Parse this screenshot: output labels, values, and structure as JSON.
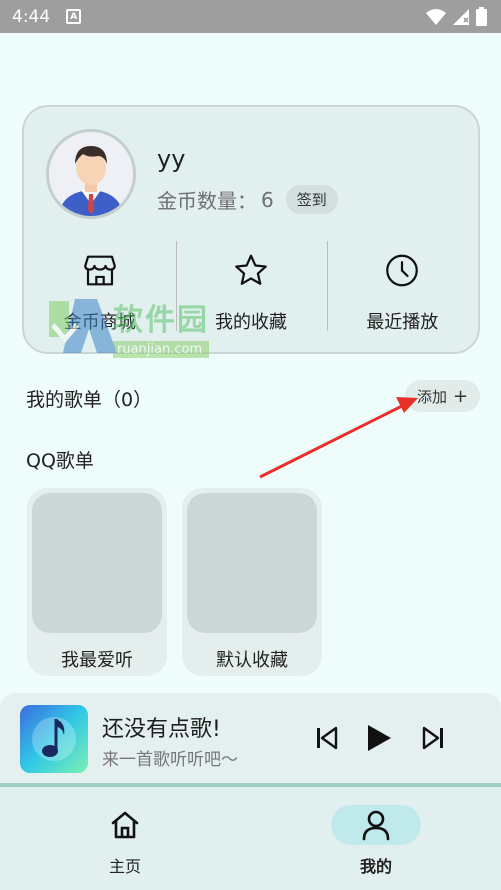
{
  "status_bar": {
    "time": "4:44",
    "notification_icon": "a-icon"
  },
  "profile": {
    "username": "yy",
    "coins_label": "金币数量：",
    "coins_value": "6",
    "checkin_label": "签到"
  },
  "quick_actions": [
    {
      "label": "金币商城",
      "icon": "shop-icon"
    },
    {
      "label": "我的收藏",
      "icon": "star-icon"
    },
    {
      "label": "最近播放",
      "icon": "clock-icon"
    }
  ],
  "watermark": {
    "cn": "软件园",
    "en": "ruanjian.com"
  },
  "my_playlists": {
    "title": "我的歌单（0）",
    "add_label": "添加"
  },
  "qq_playlists": {
    "title": "QQ歌单",
    "items": [
      {
        "name": "我最爱听"
      },
      {
        "name": "默认收藏"
      }
    ]
  },
  "player": {
    "title": "还没有点歌!",
    "subtitle": "来一首歌听听吧～"
  },
  "nav": [
    {
      "label": "主页",
      "icon": "home-icon",
      "active": false
    },
    {
      "label": "我的",
      "icon": "user-icon",
      "active": true
    }
  ],
  "colors": {
    "accent": "#bfe9ea",
    "background": "#eefdfb",
    "arrow": "#e8302a"
  }
}
